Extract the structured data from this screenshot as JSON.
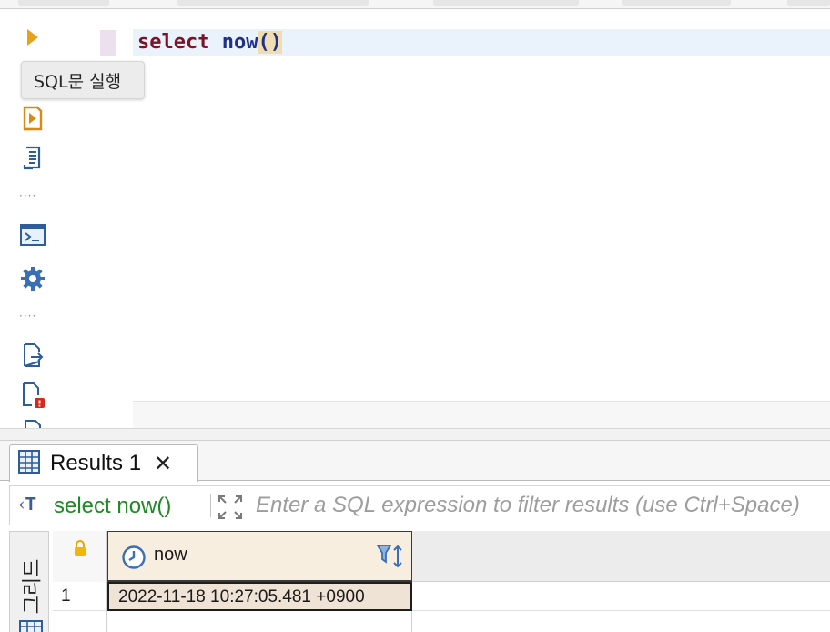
{
  "editor": {
    "code_keyword": "select",
    "code_function": "now",
    "code_parens": "()"
  },
  "toolbar": {
    "tooltip": "SQL문 실행",
    "items": [
      {
        "name": "execute-sql-icon"
      },
      {
        "name": "execute-script-icon"
      },
      {
        "name": "script-list-icon"
      },
      {
        "name": "terminal-icon"
      },
      {
        "name": "settings-gear-icon"
      },
      {
        "name": "export-icon"
      },
      {
        "name": "problem-file-icon"
      }
    ]
  },
  "results": {
    "tab_label": "Results 1",
    "filter_query": "select now()",
    "filter_placeholder": "Enter a SQL expression to filter results (use Ctrl+Space)",
    "side_label": "그리드",
    "columns": [
      {
        "label": "now",
        "type_icon": "clock-icon"
      }
    ],
    "rows": [
      {
        "num": "1",
        "values": [
          "2022-11-18 10:27:05.481 +0900"
        ]
      }
    ]
  },
  "colors": {
    "keyword": "#7a1426",
    "function": "#1e2f8c",
    "filter_query": "#1d8a24",
    "run_arrow": "#e8a21a",
    "header_selected": "#f8eee0"
  }
}
